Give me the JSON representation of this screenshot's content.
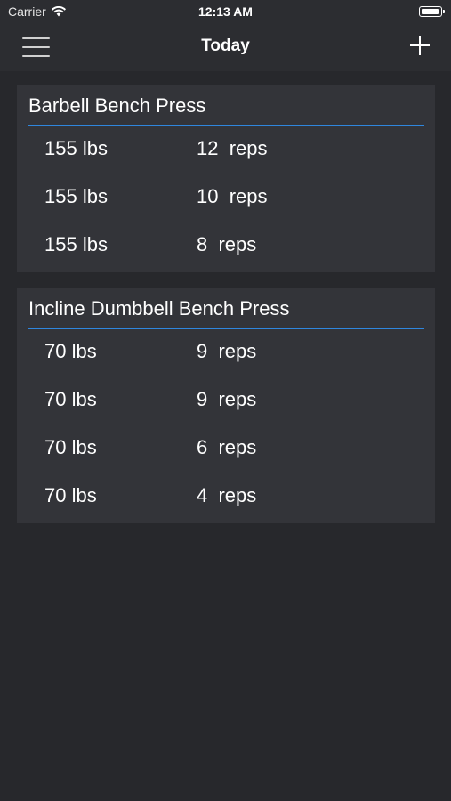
{
  "status_bar": {
    "carrier": "Carrier",
    "time": "12:13 AM"
  },
  "nav": {
    "title": "Today",
    "menu_icon": "hamburger-menu-icon",
    "add_icon": "plus-icon"
  },
  "colors": {
    "background": "#27282c",
    "card": "#333439",
    "accent": "#2f86de",
    "text": "#ffffff"
  },
  "exercises": [
    {
      "name": "Barbell Bench Press",
      "sets": [
        {
          "weight": "155 lbs",
          "reps": "12  reps"
        },
        {
          "weight": "155 lbs",
          "reps": "10  reps"
        },
        {
          "weight": "155 lbs",
          "reps": "8  reps"
        }
      ]
    },
    {
      "name": "Incline Dumbbell Bench Press",
      "sets": [
        {
          "weight": "70 lbs",
          "reps": "9  reps"
        },
        {
          "weight": "70 lbs",
          "reps": "9  reps"
        },
        {
          "weight": "70 lbs",
          "reps": "6  reps"
        },
        {
          "weight": "70 lbs",
          "reps": "4  reps"
        }
      ]
    }
  ]
}
